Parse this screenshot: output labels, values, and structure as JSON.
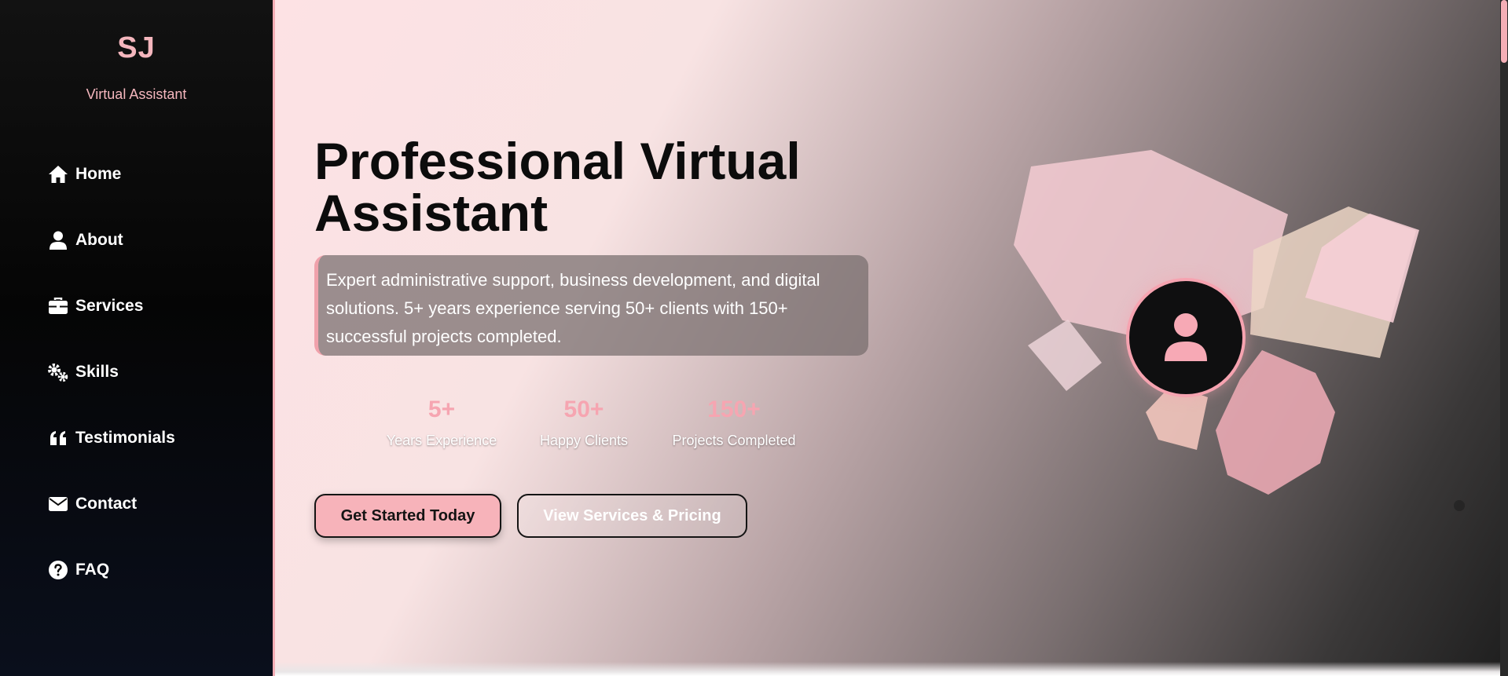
{
  "sidebar": {
    "logo": "SJ",
    "subtitle": "Virtual Assistant",
    "items": [
      {
        "label": "Home",
        "icon": "home-icon"
      },
      {
        "label": "About",
        "icon": "user-icon"
      },
      {
        "label": "Services",
        "icon": "briefcase-icon"
      },
      {
        "label": "Skills",
        "icon": "gears-icon"
      },
      {
        "label": "Testimonials",
        "icon": "quote-icon"
      },
      {
        "label": "Contact",
        "icon": "envelope-icon"
      },
      {
        "label": "FAQ",
        "icon": "question-circle-icon"
      }
    ]
  },
  "hero": {
    "title": "Professional Virtual Assistant",
    "description": "Expert administrative support, business development, and digital solutions. 5+ years experience serving 50+ clients with 150+ successful projects completed.",
    "stats": [
      {
        "value": "5+",
        "label": "Years Experience"
      },
      {
        "value": "50+",
        "label": "Happy Clients"
      },
      {
        "value": "150+",
        "label": "Projects Completed"
      }
    ],
    "primary_button": "Get Started Today",
    "secondary_button": "View Services & Pricing",
    "avatar_icon": "user-icon"
  },
  "colors": {
    "accent": "#f4aeb6",
    "sidebar_bg": "#0a0a0a",
    "title": "#0c0c0c"
  }
}
